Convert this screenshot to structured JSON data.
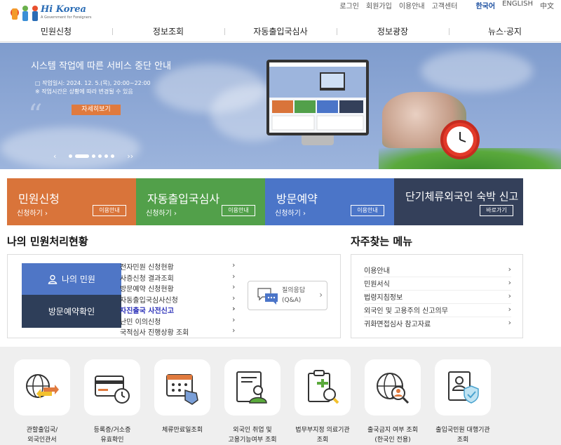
{
  "header": {
    "logo_text": "Hi Korea",
    "logo_sub": "A Government for Foreigners",
    "util": [
      "로그인",
      "회원가입",
      "이용안내",
      "고객센터"
    ],
    "lang": [
      "한국어",
      "ENGLISH",
      "中文"
    ]
  },
  "nav": [
    "민원신청",
    "정보조회",
    "자동출입국심사",
    "정보광장",
    "뉴스·공지"
  ],
  "banner": {
    "title": "시스템 작업에 따른 서비스 중단 안내",
    "line1": "□ 작업일시: 2024. 12. 5.(목), 20:00~22:00",
    "line2": "※ 작업시간은 상황에 따라 변경될 수 있음",
    "button": "자세히보기",
    "prev": "‹",
    "next": "››"
  },
  "tiles": [
    {
      "title": "민원신청",
      "sub": "신청하기 ›",
      "btn": "이용안내",
      "color": "#d9743a"
    },
    {
      "title": "자동출입국심사",
      "sub": "신청하기 ›",
      "btn": "이용안내",
      "color": "#52a04a"
    },
    {
      "title": "방문예약",
      "sub": "신청하기 ›",
      "btn": "이용안내",
      "color": "#4b75c8"
    },
    {
      "title": "단기체류외국인 숙박 신고",
      "sub": "",
      "btn": "바로가기",
      "color": "#34405a"
    }
  ],
  "my": {
    "heading": "나의 민원처리현황",
    "btn_my": "나의 민원",
    "btn_visit": "방문예약확인",
    "list": [
      "전자민원 신청현황",
      "사증신청 결과조회",
      "방문예약 신청현황",
      "자동출입국심사신청",
      "자진출국 사전신고",
      "난민 이의신청",
      "국적심사 진행상황 조회"
    ],
    "qna_line1": "질의응답",
    "qna_line2": "(Q&A)"
  },
  "freq": {
    "heading": "자주찾는 메뉴",
    "items": [
      "이용안내",
      "민원서식",
      "법령지침정보",
      "외국인 및 고용주의 신고의무",
      "귀화면접심사 참고자료"
    ]
  },
  "services": [
    {
      "line1": "관할출입국/",
      "line2": "외국인관서"
    },
    {
      "line1": "등록증/거소증",
      "line2": "유효확인"
    },
    {
      "line1": "체류만료일조회",
      "line2": ""
    },
    {
      "line1": "외국인 취업 및",
      "line2": "고용기능여부 조회"
    },
    {
      "line1": "법무부지정 의료기관",
      "line2": "조회"
    },
    {
      "line1": "출국금지 여부 조회",
      "line2": "(한국인 전용)"
    },
    {
      "line1": "출입국민원 대행기관",
      "line2": "조회"
    }
  ],
  "icons": {
    "search": "magnifier-icon",
    "user": "user-icon",
    "chat": "chat-bubble-icon"
  }
}
